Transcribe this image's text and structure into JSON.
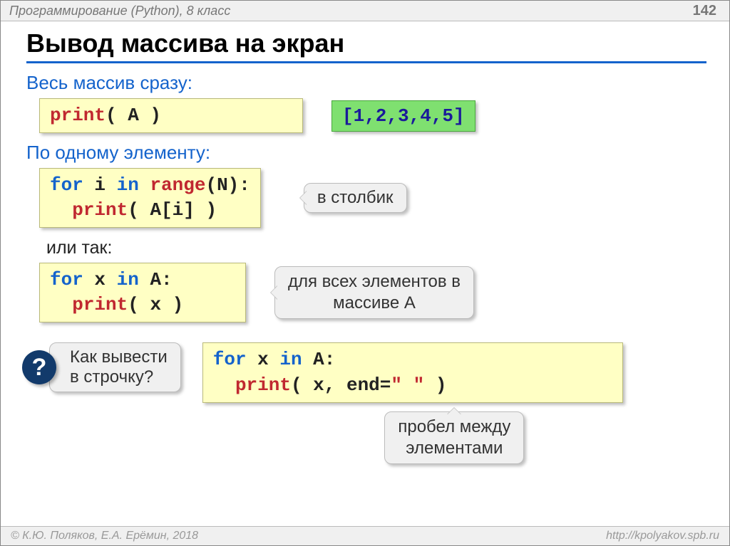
{
  "header": {
    "course": "Программирование (Python), 8 класс",
    "page": "142"
  },
  "title": "Вывод массива на экран",
  "s1": {
    "heading": "Весь массив сразу:",
    "code": {
      "fn": "print",
      "arg": "( A )"
    },
    "output": "[1,2,3,4,5]"
  },
  "s2": {
    "heading": "По одному элементу:",
    "code": {
      "kw1": "for",
      "var": " i ",
      "kw2": "in",
      "fn": " range",
      "rest": "(N):",
      "line2_fn": "print",
      "line2_rest": "( A[i] )"
    },
    "callout": "в столбик"
  },
  "s3": {
    "label": "или так:",
    "code": {
      "kw1": "for",
      "var": " x ",
      "kw2": "in",
      "rest": " A:",
      "line2_fn": "print",
      "line2_rest": "( x )"
    },
    "callout": "для всех элементов в массиве A"
  },
  "s4": {
    "q": "?",
    "question": "Как вывести\nв строчку?",
    "code": {
      "kw1": "for",
      "var": " x ",
      "kw2": "in",
      "rest": " A:",
      "line2_fn": "print",
      "line2_rest_a": "( x, end=",
      "line2_str": "\" \"",
      "line2_rest_b": " )"
    },
    "callout": "пробел между элементами"
  },
  "footer": {
    "left": "© К.Ю. Поляков, Е.А. Ерёмин, 2018",
    "right": "http://kpolyakov.spb.ru"
  }
}
